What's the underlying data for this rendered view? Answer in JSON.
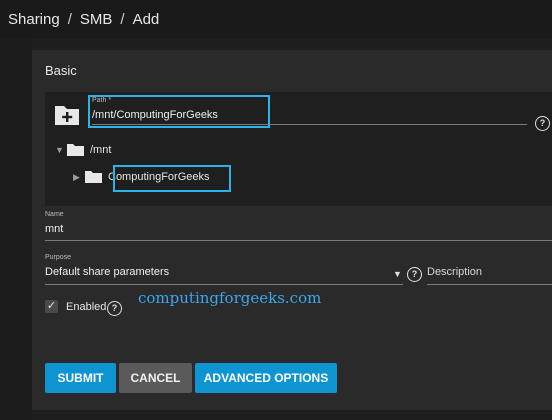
{
  "breadcrumb": {
    "items": [
      "Sharing",
      "SMB",
      "Add"
    ],
    "separator": "/"
  },
  "card": {
    "title": "Basic"
  },
  "explorer": {
    "path_label": "Path *",
    "path_value": "/mnt/ComputingForGeeks",
    "tree": [
      {
        "label": "/mnt",
        "expanded": true
      },
      {
        "label": "ComputingForGeeks",
        "expanded": false
      }
    ]
  },
  "name_field": {
    "label": "Name",
    "value": "mnt"
  },
  "purpose_field": {
    "label": "Purpose",
    "value": "Default share parameters"
  },
  "description_field": {
    "placeholder": "Description"
  },
  "enabled": {
    "label": "Enabled",
    "checked": true
  },
  "watermark": "computingforgeeks.com",
  "buttons": {
    "submit": "SUBMIT",
    "cancel": "CANCEL",
    "advanced": "ADVANCED OPTIONS"
  },
  "colors": {
    "accent": "#0f94d2",
    "highlight": "#2bb4e8",
    "background": "#1e1e1e",
    "card": "#2a2a2a"
  },
  "icons": {
    "add_folder": "folder-plus-icon",
    "folder": "folder-icon",
    "help": "help-circle-icon",
    "checkbox": "check-icon"
  }
}
